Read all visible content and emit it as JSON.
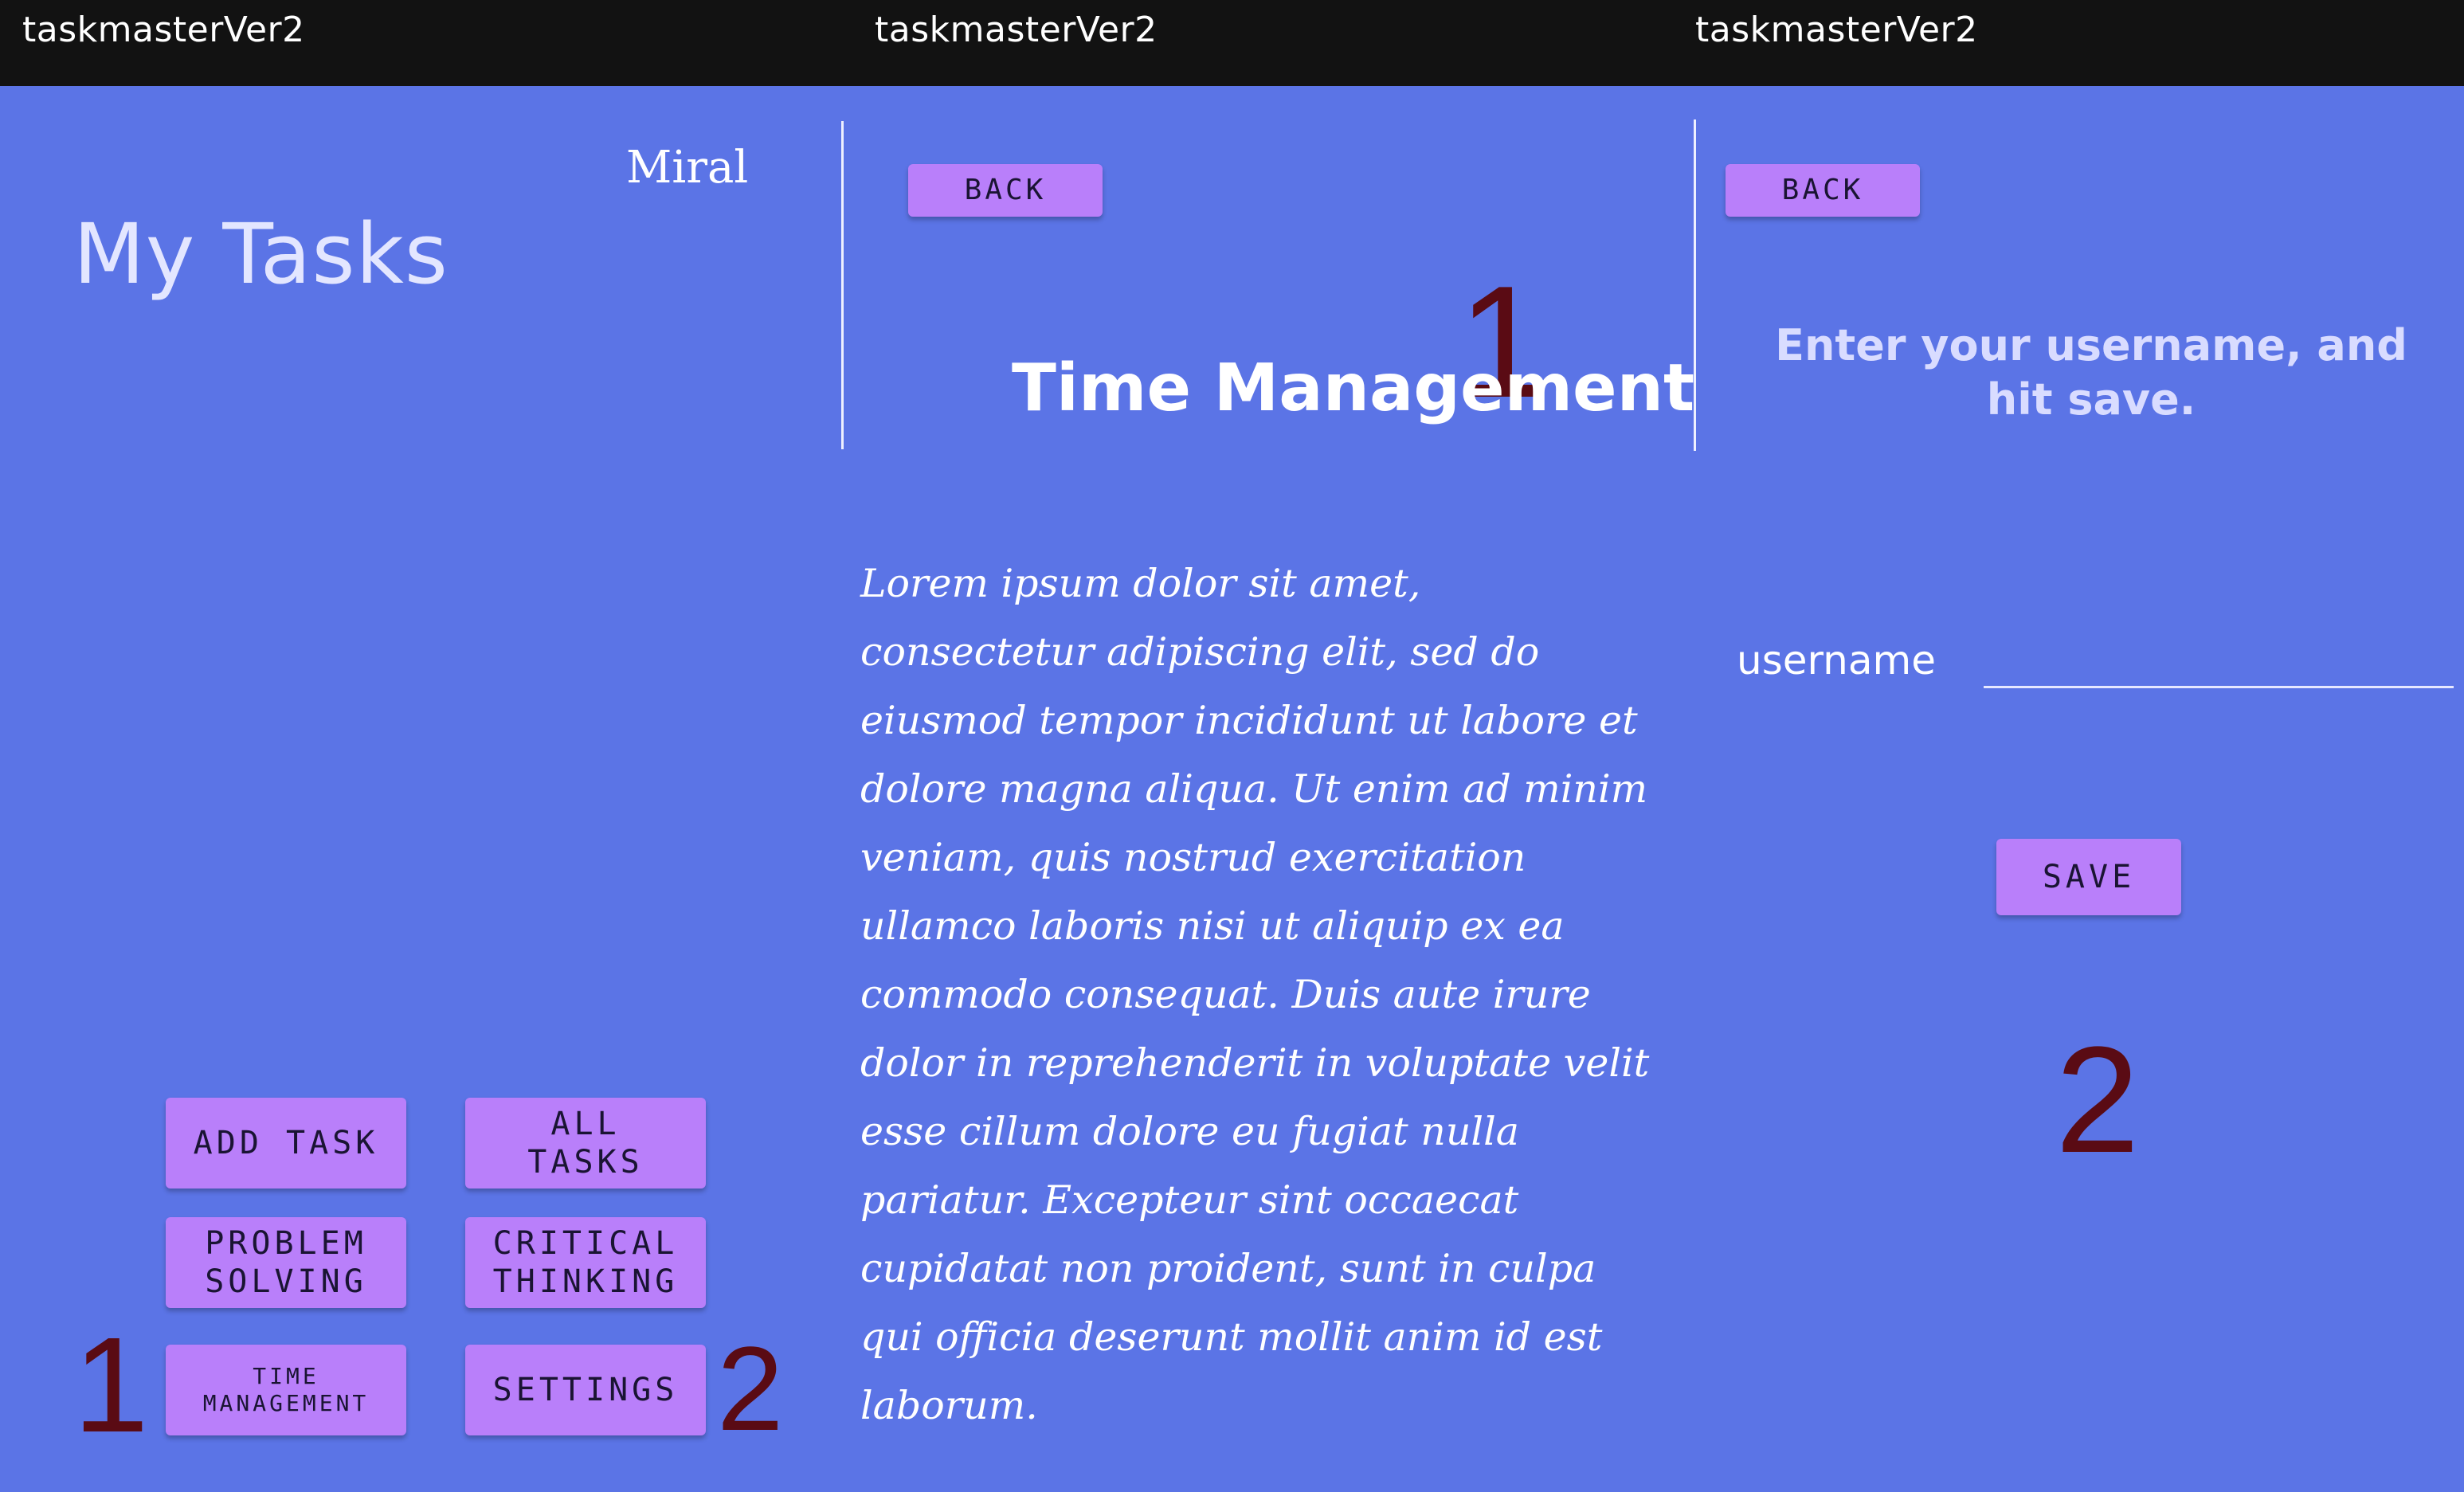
{
  "app": {
    "title_1": "taskmasterVer2",
    "title_2": "taskmasterVer2",
    "title_3": "taskmasterVer2"
  },
  "home": {
    "heading": "My Tasks",
    "user_name": "Miral",
    "buttons": {
      "add_task": "ADD TASK",
      "all_tasks_1": "ALL",
      "all_tasks_2": "TASKS",
      "problem_solving_1": "PROBLEM",
      "problem_solving_2": "SOLVING",
      "critical_thinking_1": "CRITICAL",
      "critical_thinking_2": "THINKING",
      "time_management_1": "TIME",
      "time_management_2": "MANAGEMENT",
      "settings": "SETTINGS"
    },
    "annotation_left": "1",
    "annotation_right": "2"
  },
  "detail": {
    "back_label": "BACK",
    "annotation": "1",
    "title": "Time Management",
    "body": "Lorem ipsum dolor sit amet, consectetur adipiscing elit, sed do eiusmod tempor incididunt ut labore et dolore magna aliqua. Ut enim ad minim veniam, quis nostrud exercitation ullamco laboris nisi ut aliquip ex ea commodo consequat. Duis aute irure dolor in reprehenderit in voluptate velit esse cillum dolore eu fugiat nulla pariatur. Excepteur sint occaecat cupidatat non proident, sunt in culpa qui officia deserunt mollit anim id est laborum."
  },
  "settings": {
    "back_label": "BACK",
    "prompt": "Enter your username, and hit save.",
    "username_label": "username",
    "username_value": "",
    "save_label": "SAVE",
    "annotation": "2"
  },
  "colors": {
    "background": "#5b74e6",
    "topbar": "#121212",
    "button": "#b97ffa",
    "annotation": "#5a0b14"
  }
}
